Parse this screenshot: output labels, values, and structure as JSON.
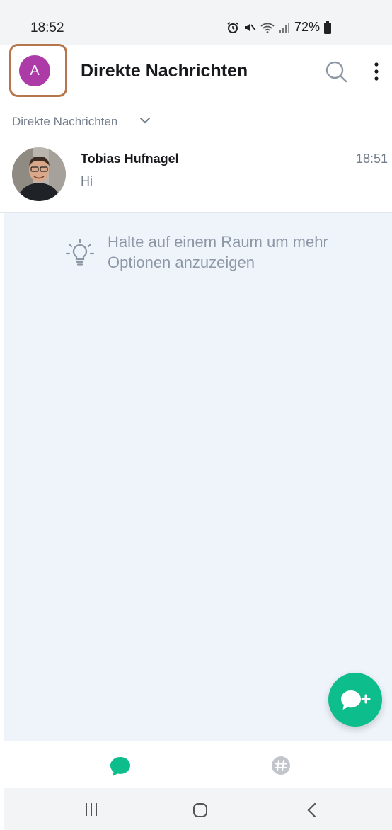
{
  "status_bar": {
    "time": "18:52",
    "battery_percent": "72%",
    "icons": [
      "alarm-icon",
      "mute-icon",
      "wifi-icon",
      "signal-icon",
      "battery-icon"
    ]
  },
  "header": {
    "avatar_initial": "A",
    "avatar_color": "#ac3ba8",
    "title": "Direkte Nachrichten",
    "icons": [
      "search-icon",
      "more-vert-icon"
    ]
  },
  "section": {
    "label": "Direkte Nachrichten",
    "icon": "chevron-down-icon"
  },
  "rooms": [
    {
      "name": "Tobias Hufnagel",
      "time": "18:51",
      "preview": "Hi"
    }
  ],
  "hint": {
    "icon": "lightbulb-icon",
    "text": "Halte auf einem Raum um mehr Optionen anzuzeigen"
  },
  "fab": {
    "icon": "new-chat-icon",
    "color": "#0dbd8b"
  },
  "bottom_nav": {
    "items": [
      {
        "icon": "chat-bubble-icon",
        "active": true
      },
      {
        "icon": "rooms-hash-icon",
        "active": false
      }
    ]
  },
  "system_nav": [
    "recents-icon",
    "home-icon",
    "back-icon"
  ]
}
